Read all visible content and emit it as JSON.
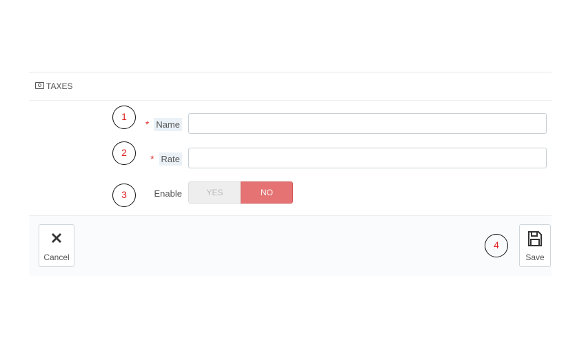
{
  "panel": {
    "title": "TAXES",
    "title_icon": "money-icon"
  },
  "form": {
    "name": {
      "required_mark": "*",
      "label": "Name",
      "value": ""
    },
    "rate": {
      "required_mark": "*",
      "label": "Rate",
      "value": ""
    },
    "enable": {
      "label": "Enable",
      "yes_label": "YES",
      "no_label": "NO",
      "selected": "NO"
    }
  },
  "footer": {
    "cancel_label": "Cancel",
    "cancel_icon": "close-x-icon",
    "save_label": "Save",
    "save_icon": "floppy-disk-icon"
  },
  "annotations": {
    "marker_1": "1",
    "marker_2": "2",
    "marker_3": "3",
    "marker_4": "4"
  },
  "colors": {
    "required": "#e03030",
    "toggle_no_active": "#e57373",
    "toggle_yes_inactive": "#eeeeee",
    "annotation_number": "#e02020"
  }
}
